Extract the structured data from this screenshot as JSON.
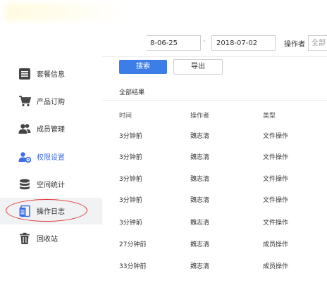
{
  "filters": {
    "date_start": "8-06-25",
    "date_separator": "-",
    "date_end": "2018-07-02",
    "operator_label": "操作者",
    "operator_value": "全部"
  },
  "sidebar": {
    "items": [
      {
        "label": "套餐信息"
      },
      {
        "label": "产品订购"
      },
      {
        "label": "成员管理"
      },
      {
        "label": "权限设置"
      },
      {
        "label": "空间统计"
      },
      {
        "label": "操作日志"
      },
      {
        "label": "回收站"
      }
    ]
  },
  "toolbar": {
    "search_label": "搜索",
    "export_label": "导出"
  },
  "results": {
    "label": "全部结果",
    "columns": [
      "时间",
      "操作者",
      "类型"
    ],
    "rows": [
      {
        "time": "3分钟前",
        "operator": "魏志清",
        "type": "文件操作"
      },
      {
        "time": "3分钟前",
        "operator": "魏志清",
        "type": "文件操作"
      },
      {
        "time": "3分钟前",
        "operator": "魏志清",
        "type": "文件操作"
      },
      {
        "time": "3分钟前",
        "operator": "魏志清",
        "type": "文件操作"
      },
      {
        "time": "3分钟前",
        "operator": "魏志清",
        "type": "文件操作"
      },
      {
        "time": "27分钟前",
        "operator": "魏志清",
        "type": "成员操作"
      },
      {
        "time": "33分钟前",
        "operator": "魏志清",
        "type": "成员操作"
      }
    ]
  },
  "colors": {
    "accent": "#3d7de8",
    "active_nav": "#3d6fe8",
    "highlight_oval": "#e03a3a",
    "icon": "#444444"
  },
  "icons": {
    "sidebar": [
      "list-icon",
      "cart-icon",
      "users-icon",
      "user-settings-icon",
      "database-icon",
      "document-icon",
      "trash-icon"
    ]
  }
}
